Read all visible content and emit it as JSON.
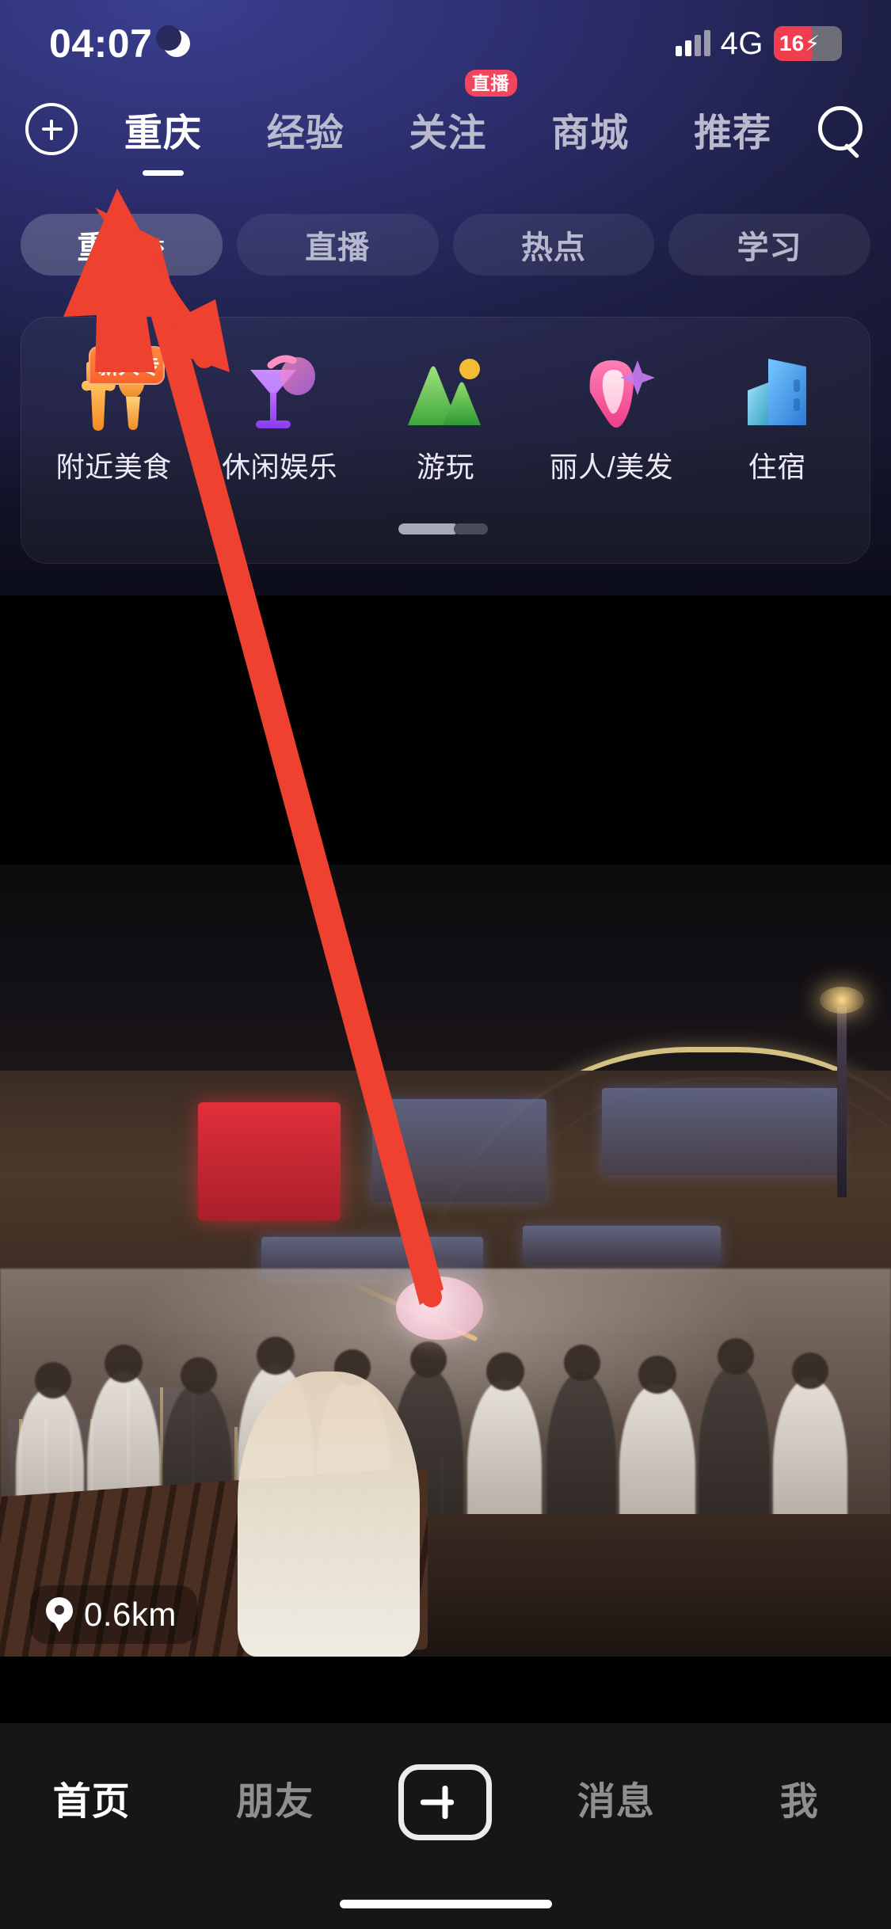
{
  "status_bar": {
    "time": "04:07",
    "moon_icon": "moon-icon",
    "network": "4G",
    "battery_percent": "16",
    "battery_charging_glyph": "⚡",
    "signal_icon": "signal-bars-icon"
  },
  "top_nav": {
    "add_icon": "plus-circle-icon",
    "search_icon": "search-icon",
    "tabs": [
      {
        "label": "重庆",
        "active": true
      },
      {
        "label": "经验",
        "active": false
      },
      {
        "label": "关注",
        "active": false,
        "badge": "直播"
      },
      {
        "label": "商城",
        "active": false
      },
      {
        "label": "推荐",
        "active": false
      }
    ]
  },
  "chips": [
    {
      "label": "重庆",
      "suffix": "⇆",
      "active": true
    },
    {
      "label": "直播",
      "suffix": "",
      "active": false
    },
    {
      "label": "热点",
      "suffix": "",
      "active": false
    },
    {
      "label": "学习",
      "suffix": "",
      "active": false
    }
  ],
  "categories": [
    {
      "label": "附近美食",
      "icon": "cutlery-icon",
      "badge": "新人专"
    },
    {
      "label": "休闲娱乐",
      "icon": "cocktail-icon",
      "badge": ""
    },
    {
      "label": "游玩",
      "icon": "mountain-icon",
      "badge": ""
    },
    {
      "label": "丽人/美发",
      "icon": "beauty-icon",
      "badge": ""
    },
    {
      "label": "住宿",
      "icon": "hotel-building-icon",
      "badge": ""
    }
  ],
  "video": {
    "distance_label": "0.6km",
    "location_icon": "location-pin-icon"
  },
  "bottom_nav": [
    {
      "label": "首页",
      "active": true
    },
    {
      "label": "朋友",
      "active": false
    },
    {
      "label": "",
      "active": false,
      "icon": "plus-box-icon"
    },
    {
      "label": "消息",
      "active": false
    },
    {
      "label": "我",
      "active": false
    }
  ],
  "annotation": {
    "type": "arrow",
    "color": "#ef4130",
    "points_to": "重庆 city filter chip"
  },
  "colors": {
    "accent_red": "#f3445e",
    "annotation_red": "#ef4130",
    "badge_orange": "#f8622d",
    "panel_purple": "#2b2d6b",
    "bottom_bar": "#161616"
  }
}
